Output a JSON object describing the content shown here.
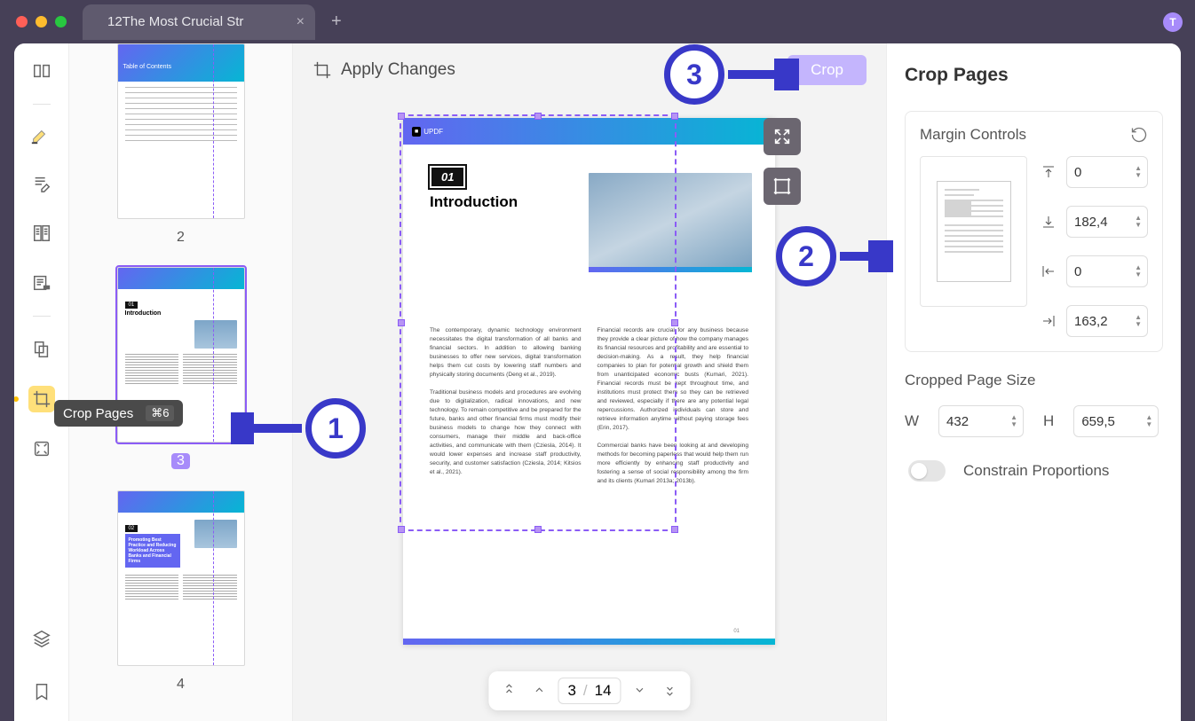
{
  "titlebar": {
    "tab_title": "12The Most Crucial Str",
    "avatar_letter": "T"
  },
  "rail": {
    "tooltip_label": "Crop Pages",
    "tooltip_shortcut": "⌘6"
  },
  "thumbs": {
    "pages": [
      {
        "num": "2",
        "heading": "Table of Contents",
        "selected": false
      },
      {
        "num": "3",
        "heading": "Introduction",
        "badge": "01",
        "selected": true
      },
      {
        "num": "4",
        "heading": "Promoting Best Practice and Reducing Workload Across Banks and Financial Firms",
        "badge": "02",
        "selected": false
      }
    ]
  },
  "center": {
    "apply_label": "Apply Changes",
    "crop_label": "Crop",
    "doc": {
      "logo": "UPDF",
      "badge": "01",
      "title": "Introduction",
      "col1_p1": "The contemporary, dynamic technology environ­ment necessitates the digital transformation of all banks and financial sectors. In addition to allowing banking businesses to offer new services, digital transformation helps them cut costs by lowering staff numbers and physically storing documents (Deng et al., 2019).",
      "col1_p2": "Traditional business models and procedures are evolving due to digitalization, radical innovations, and new technology. To remain competitive and be prepared for the future, banks and other financial firms must modify their business models to change how they connect with consumers, manage their middle and back-office activities, and communi­cate with them (Cziesla, 2014). It would lower expenses and increase staff productivity, security, and customer satisfaction (Cziesla, 2014; Kitsios et al., 2021).",
      "col2_p1": "Financial records are crucial for any business because they provide a clear picture of how the company manages its financial resources and profitability and are essential to decision-making. As a result, they help financial companies to plan for potential growth and shield them from unantic­ipated economic busts (Kumari, 2021). Financial records must be kept throughout time, and institu­tions must protect them so they can be retrieved and reviewed, especially if there are any potential legal repercussions. Authorized individuals can store and retrieve information anytime without paying storage fees (Erin, 2017).",
      "col2_p2": "Commercial banks have been looking at and developing methods for becoming paperless that would help them run more efficiently by enhanc­ing staff productivity and fostering a sense of social responsibility among the firm and its clients (Kumari 2013a; 2013b).",
      "footer": "01"
    },
    "pager": {
      "current": "3",
      "sep": "/",
      "total": "14"
    }
  },
  "panel": {
    "title": "Crop Pages",
    "margin_title": "Margin Controls",
    "margins": {
      "top": "0",
      "bottom": "182,4",
      "left": "0",
      "right": "163,2"
    },
    "size_title": "Cropped Page Size",
    "size": {
      "w_label": "W",
      "w": "432",
      "h_label": "H",
      "h": "659,5"
    },
    "constrain": "Constrain Proportions"
  },
  "callouts": {
    "c1": "1",
    "c2": "2",
    "c3": "3"
  }
}
